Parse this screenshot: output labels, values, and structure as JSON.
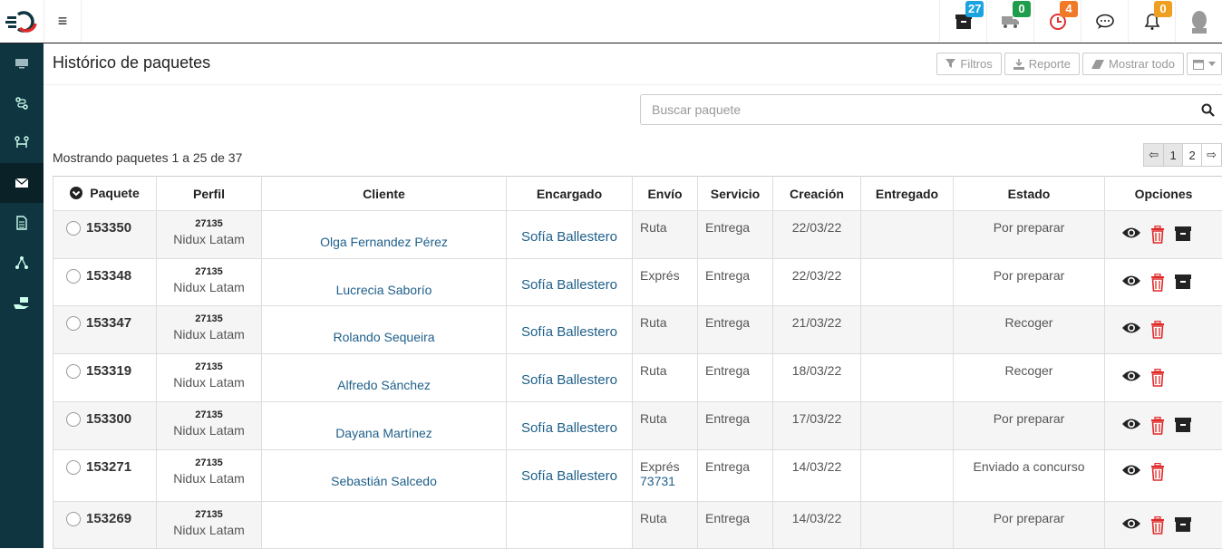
{
  "topbar": {
    "badges": [
      {
        "icon": "archive-icon",
        "count": "27",
        "color": "#1aa3e0"
      },
      {
        "icon": "truck-icon",
        "count": "0",
        "color": "#1e9e4a"
      },
      {
        "icon": "clock-icon",
        "count": "4",
        "color": "#f07a28"
      },
      {
        "icon": "chat-icon",
        "count": "",
        "color": ""
      },
      {
        "icon": "bell-icon",
        "count": "0",
        "color": "#f0a020"
      },
      {
        "icon": "avatar-icon",
        "count": "",
        "color": ""
      }
    ]
  },
  "page": {
    "title": "Histórico de paquetes",
    "buttons": {
      "filters": "Filtros",
      "report": "Reporte",
      "show_all": "Mostrar todo"
    },
    "search_placeholder": "Buscar paquete",
    "showing": "Mostrando paquetes 1 a 25 de 37",
    "pager": [
      "⇦",
      "1",
      "2",
      "⇨"
    ]
  },
  "table": {
    "headers": [
      "Paquete",
      "Perfil",
      "Cliente",
      "Encargado",
      "Envío",
      "Servicio",
      "Creación",
      "Entregado",
      "Estado",
      "Opciones"
    ],
    "rows": [
      {
        "id": "153350",
        "code": "27135",
        "profile": "Nidux Latam",
        "client": "Olga Fernandez Pérez",
        "agent": "Sofía Ballestero",
        "ship": "Ruta",
        "ship_extra": "",
        "service": "Entrega",
        "created": "22/03/22",
        "delivered": "",
        "status": "Por preparar",
        "archive": true
      },
      {
        "id": "153348",
        "code": "27135",
        "profile": "Nidux Latam",
        "client": "Lucrecia Saborío",
        "agent": "Sofía Ballestero",
        "ship": "Exprés",
        "ship_extra": "",
        "service": "Entrega",
        "created": "22/03/22",
        "delivered": "",
        "status": "Por preparar",
        "archive": true
      },
      {
        "id": "153347",
        "code": "27135",
        "profile": "Nidux Latam",
        "client": "Rolando Sequeira",
        "agent": "Sofía Ballestero",
        "ship": "Ruta",
        "ship_extra": "",
        "service": "Entrega",
        "created": "21/03/22",
        "delivered": "",
        "status": "Recoger",
        "archive": false
      },
      {
        "id": "153319",
        "code": "27135",
        "profile": "Nidux Latam",
        "client": "Alfredo Sánchez",
        "agent": "Sofía Ballestero",
        "ship": "Ruta",
        "ship_extra": "",
        "service": "Entrega",
        "created": "18/03/22",
        "delivered": "",
        "status": "Recoger",
        "archive": false
      },
      {
        "id": "153300",
        "code": "27135",
        "profile": "Nidux Latam",
        "client": "Dayana Martínez",
        "agent": "Sofía Ballestero",
        "ship": "Ruta",
        "ship_extra": "",
        "service": "Entrega",
        "created": "17/03/22",
        "delivered": "",
        "status": "Por preparar",
        "archive": true
      },
      {
        "id": "153271",
        "code": "27135",
        "profile": "Nidux Latam",
        "client": "Sebastián Salcedo",
        "agent": "Sofía Ballestero",
        "ship": "Exprés",
        "ship_extra": "73731",
        "service": "Entrega",
        "created": "14/03/22",
        "delivered": "",
        "status": "Enviado a concurso",
        "archive": false
      },
      {
        "id": "153269",
        "code": "27135",
        "profile": "Nidux Latam",
        "client": "",
        "agent": "",
        "ship": "Ruta",
        "ship_extra": "",
        "service": "Entrega",
        "created": "14/03/22",
        "delivered": "",
        "status": "Por preparar",
        "archive": true
      }
    ]
  }
}
